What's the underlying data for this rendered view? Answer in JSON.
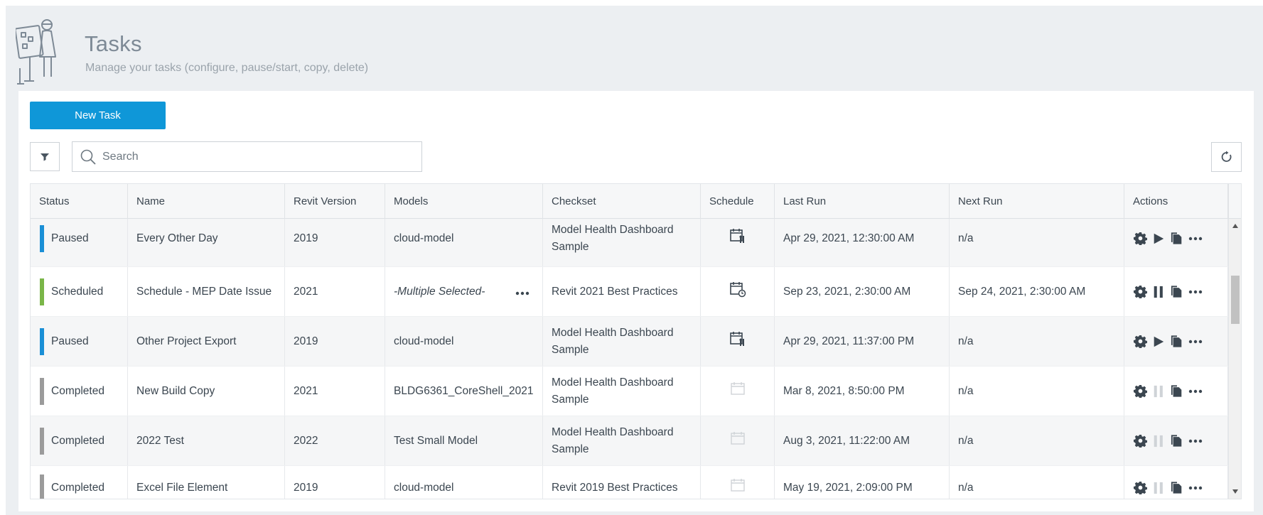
{
  "header": {
    "title": "Tasks",
    "subtitle": "Manage your tasks (configure, pause/start, copy, delete)"
  },
  "toolbar": {
    "new_task_label": "New Task",
    "search_placeholder": "Search"
  },
  "table": {
    "columns": [
      "Status",
      "Name",
      "Revit Version",
      "Models",
      "Checkset",
      "Schedule",
      "Last Run",
      "Next Run",
      "Actions"
    ],
    "rows": [
      {
        "status": "Paused",
        "name": "Every Other Day",
        "version": "2019",
        "models": "cloud-model",
        "checkset": "Model Health Dashboard Sample",
        "schedule_icon": "calendar-recurring-icon",
        "last_run": "Apr 29, 2021, 12:30:00 AM",
        "next_run": "n/a",
        "toggle": "play"
      },
      {
        "status": "Scheduled",
        "name": "Schedule - MEP Date Issue",
        "version": "2021",
        "models": "-Multiple Selected-",
        "checkset": "Revit 2021 Best Practices",
        "schedule_icon": "calendar-clock-icon",
        "last_run": "Sep 23, 2021, 2:30:00 AM",
        "next_run": "Sep 24, 2021, 2:30:00 AM",
        "toggle": "pause"
      },
      {
        "status": "Paused",
        "name": "Other Project Export",
        "version": "2019",
        "models": "cloud-model",
        "checkset": "Model Health Dashboard Sample",
        "schedule_icon": "calendar-recurring-icon",
        "last_run": "Apr 29, 2021, 11:37:00 PM",
        "next_run": "n/a",
        "toggle": "play"
      },
      {
        "status": "Completed",
        "name": "New Build Copy",
        "version": "2021",
        "models": "BLDG6361_CoreShell_2021",
        "checkset": "Model Health Dashboard Sample",
        "schedule_icon": "calendar-empty-icon",
        "last_run": "Mar 8, 2021, 8:50:00 PM",
        "next_run": "n/a",
        "toggle": "pause-disabled"
      },
      {
        "status": "Completed",
        "name": "2022 Test",
        "version": "2022",
        "models": "Test Small Model",
        "checkset": "Model Health Dashboard Sample",
        "schedule_icon": "calendar-empty-icon",
        "last_run": "Aug 3, 2021, 11:22:00 AM",
        "next_run": "n/a",
        "toggle": "pause-disabled"
      },
      {
        "status": "Completed",
        "name": "Excel File Element",
        "version": "2019",
        "models": "cloud-model",
        "checkset": "Revit 2019 Best Practices",
        "schedule_icon": "calendar-empty-icon",
        "last_run": "May 19, 2021, 2:09:00 PM",
        "next_run": "n/a",
        "toggle": "pause-disabled"
      }
    ]
  },
  "colors": {
    "accent": "#0f97d8",
    "status_paused": "#1a8fd6",
    "status_scheduled": "#7ab648",
    "status_completed": "#9b9b9b",
    "icon": "#3b4650",
    "icon_disabled": "#cfd3d7"
  }
}
